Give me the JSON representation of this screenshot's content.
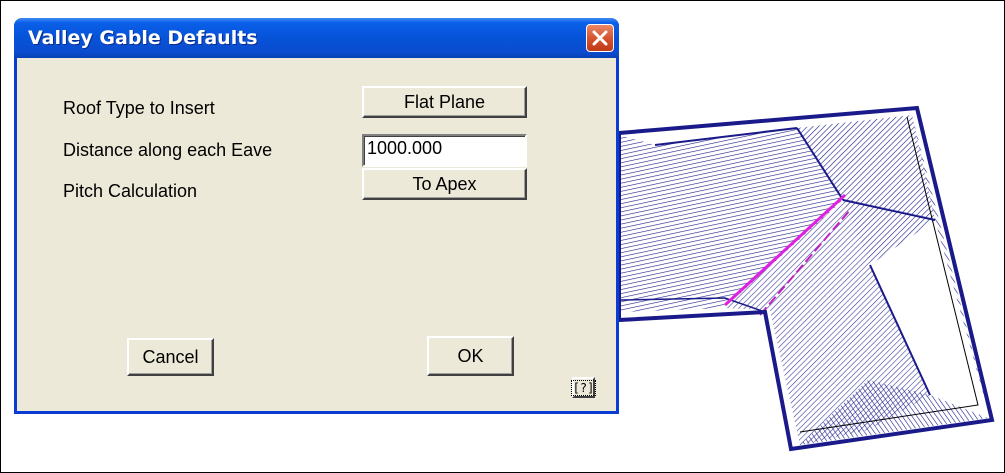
{
  "dialog": {
    "title": "Valley Gable Defaults",
    "fields": {
      "roof_type_label": "Roof Type to Insert",
      "roof_type_value": "Flat Plane",
      "distance_label": "Distance along each Eave",
      "distance_value": "1000.000",
      "pitch_label": "Pitch Calculation",
      "pitch_value": "To Apex"
    },
    "buttons": {
      "cancel": "Cancel",
      "ok": "OK",
      "help": "[?]"
    }
  },
  "colors": {
    "titlebar": "#0653d8",
    "dialog_bg": "#ece9d8",
    "roof_lines": "#1a1a8a",
    "valley_highlight": "#e020e0"
  },
  "icons": {
    "close": "close-x-icon"
  }
}
